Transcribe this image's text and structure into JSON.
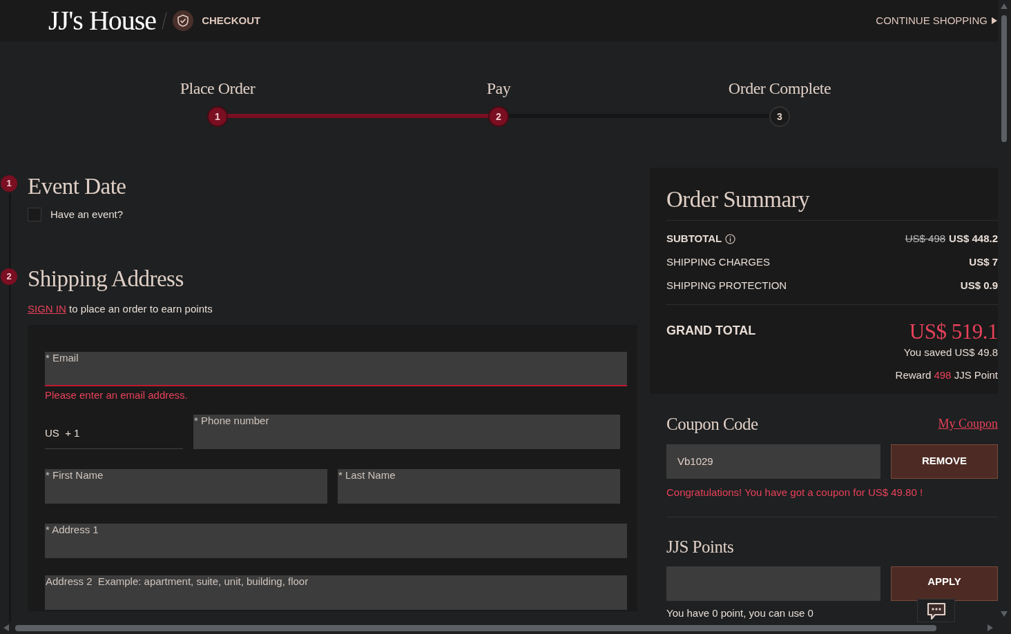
{
  "header": {
    "logo": "JJ's House",
    "section": "CHECKOUT",
    "continue_link": "CONTINUE SHOPPING"
  },
  "steps": [
    {
      "number": "1",
      "label": "Place Order",
      "done": true
    },
    {
      "number": "2",
      "label": "Pay",
      "done": true
    },
    {
      "number": "3",
      "label": "Order Complete",
      "done": false
    }
  ],
  "sections": [
    {
      "number": "1",
      "title": "Event Date"
    },
    {
      "number": "2",
      "title": "Shipping Address"
    }
  ],
  "event": {
    "label": "Have an event?",
    "checked": false
  },
  "sign_in": {
    "link": "SIGN IN",
    "text": "to place an order to earn points"
  },
  "form": {
    "email": {
      "placeholder": "* Email",
      "invalid": true,
      "error": "Please enter an email address."
    },
    "country_code": "US  + 1",
    "phone": {
      "placeholder": "* Phone number"
    },
    "first_name": {
      "placeholder": "* First Name"
    },
    "last_name": {
      "placeholder": "* Last Name"
    },
    "address_1": {
      "placeholder": "* Address 1"
    },
    "address_2": {
      "placeholder": "Address 2  Example: apartment, suite, unit, building, floor"
    }
  },
  "order_summary": {
    "title": "Order Summary",
    "rows": [
      {
        "kind": "subtotal",
        "label": "SUBTOTAL",
        "old_value": "US$ 498",
        "value": "US$ 448.2"
      },
      {
        "kind": "charge",
        "label": "SHIPPING CHARGES",
        "value": "US$ 7"
      },
      {
        "kind": "charge",
        "label": "SHIPPING PROTECTION",
        "value": "US$ 0.9"
      }
    ],
    "grand_total": {
      "label": "GRAND TOTAL",
      "value": "US$ 519.1"
    },
    "saved": "You saved US$ 49.8",
    "reward": {
      "prefix": "Reward",
      "points": "498",
      "suffix": "JJS Point"
    }
  },
  "coupon": {
    "title": "Coupon Code",
    "link": "My Coupon",
    "value": "Vb1029",
    "button": "REMOVE",
    "message": "Congratulations! You have got a coupon for US$ 49.80 !"
  },
  "points": {
    "title": "JJS Points",
    "button": "APPLY",
    "note": "You have 0 point, you can use 0"
  }
}
